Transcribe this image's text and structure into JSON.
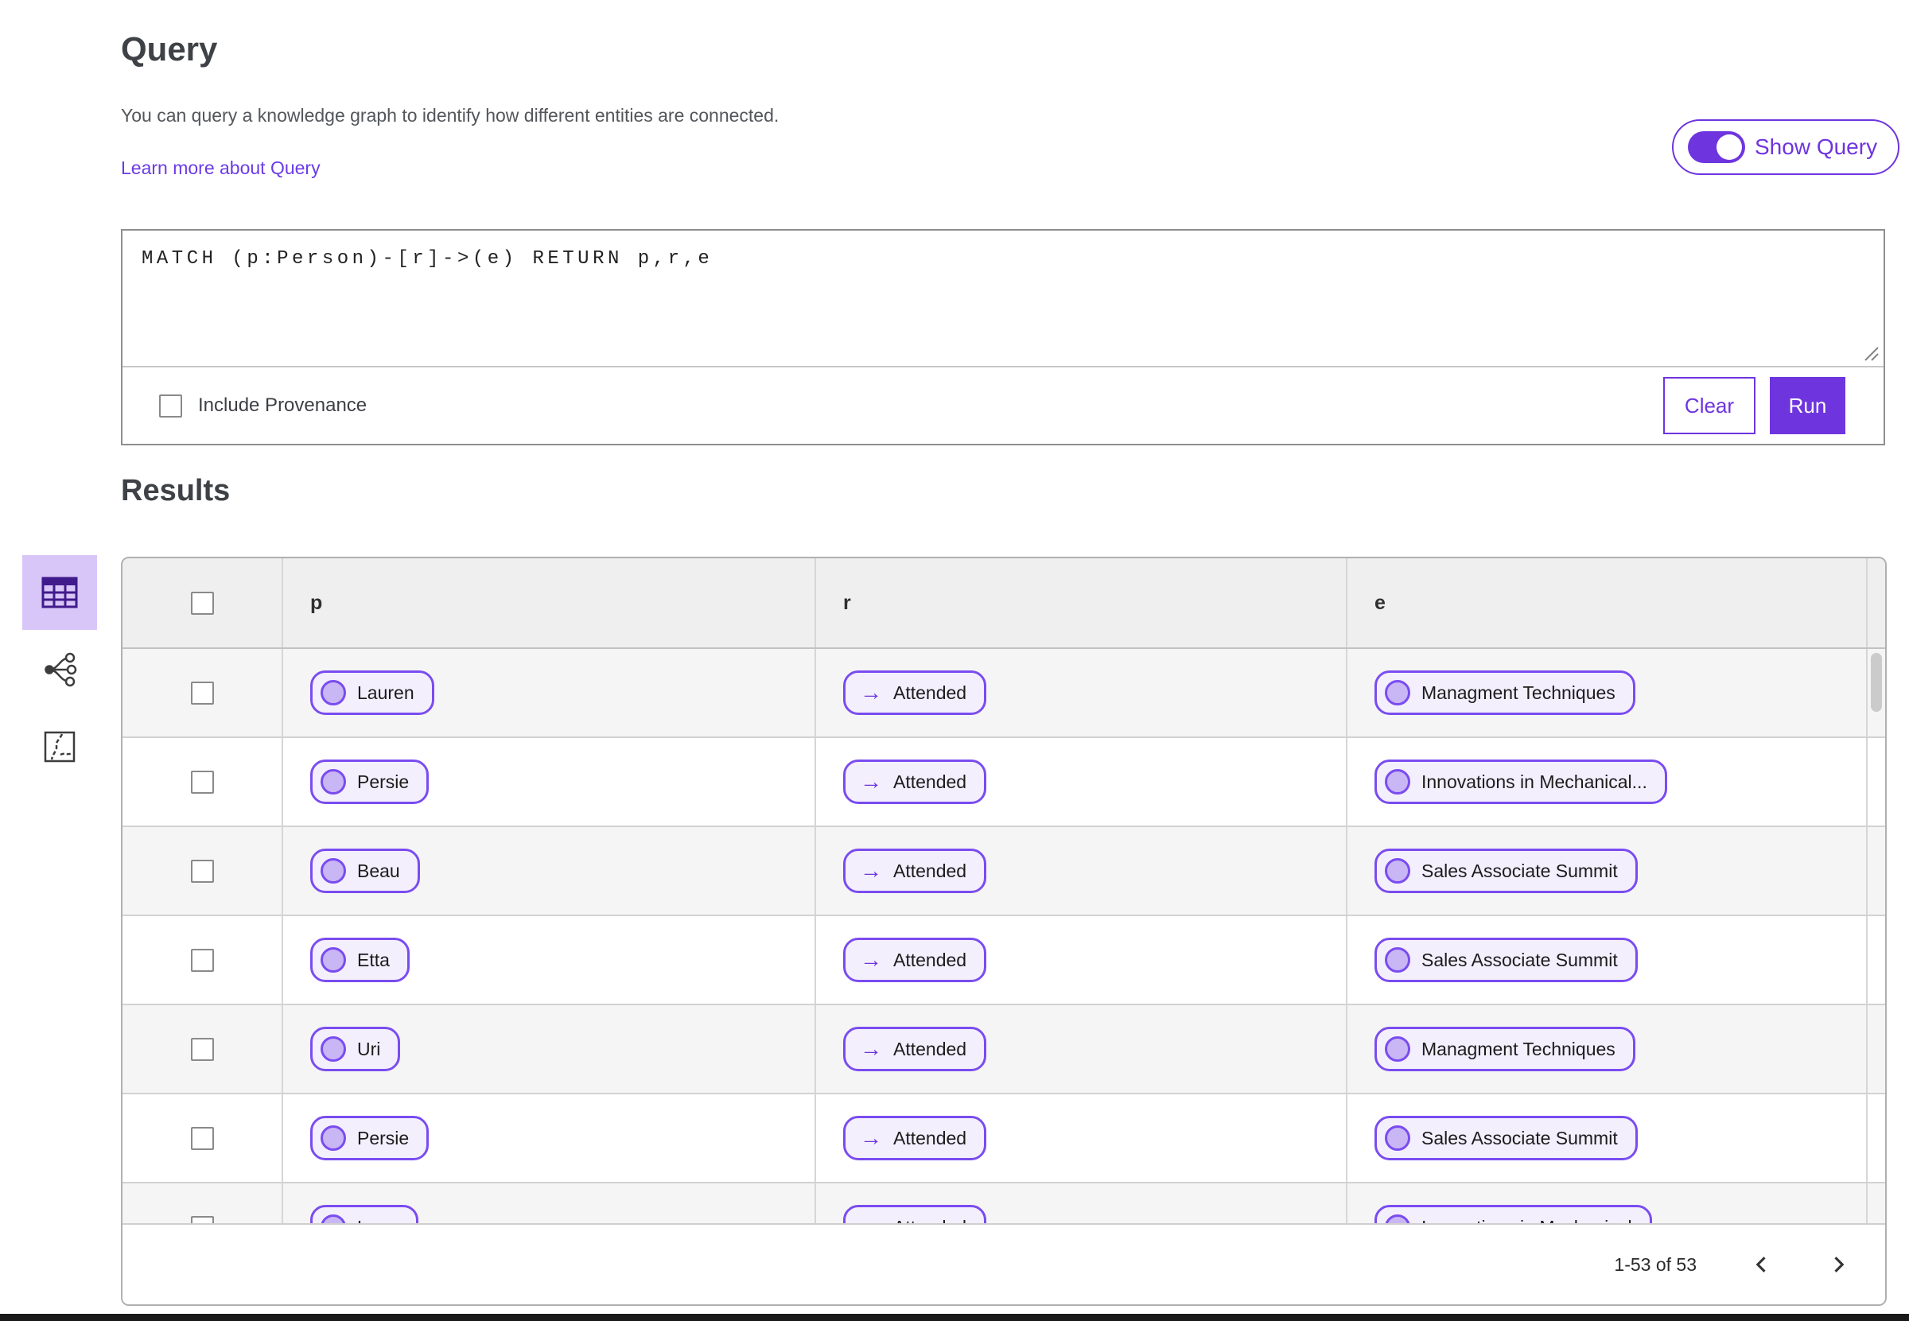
{
  "page": {
    "title": "Query",
    "description": "You can query a knowledge graph to identify how different entities are connected.",
    "learn_more_link": "Learn more about Query",
    "show_query_toggle": {
      "label": "Show Query",
      "state": "on"
    }
  },
  "query_panel": {
    "query_text": "MATCH (p:Person)-[r]->(e) RETURN p,r,e",
    "include_provenance": {
      "label": "Include Provenance",
      "checked": false
    },
    "buttons": {
      "clear": "Clear",
      "run": "Run"
    }
  },
  "results": {
    "heading": "Results",
    "view_switcher": [
      {
        "icon": "table-view-icon",
        "selected": true
      },
      {
        "icon": "graph-view-icon",
        "selected": false
      },
      {
        "icon": "map-view-icon",
        "selected": false
      }
    ],
    "table": {
      "columns": [
        "p",
        "r",
        "e"
      ],
      "rows": [
        {
          "p": "Lauren",
          "r": "Attended",
          "e": "Managment Techniques"
        },
        {
          "p": "Persie",
          "r": "Attended",
          "e": "Innovations in Mechanical..."
        },
        {
          "p": "Beau",
          "r": "Attended",
          "e": "Sales Associate Summit"
        },
        {
          "p": "Etta",
          "r": "Attended",
          "e": "Sales Associate Summit"
        },
        {
          "p": "Uri",
          "r": "Attended",
          "e": "Managment Techniques"
        },
        {
          "p": "Persie",
          "r": "Attended",
          "e": "Sales Associate Summit"
        },
        {
          "p": "Larry",
          "r": "Attended",
          "e": "Innovations in Mechanical"
        }
      ]
    },
    "pagination": {
      "range_label": "1-53 of 53"
    }
  },
  "colors": {
    "accent": "#6e35df",
    "accent_dark": "#401b8c",
    "pill_border": "#7a4cf0",
    "pill_background": "#f3effd",
    "pill_dot": "#c9b6f4",
    "selected_view_background": "#d8c6f9",
    "link": "#6b3be6",
    "table_header_background": "#efefef",
    "row_stripe": "#f5f5f5"
  }
}
